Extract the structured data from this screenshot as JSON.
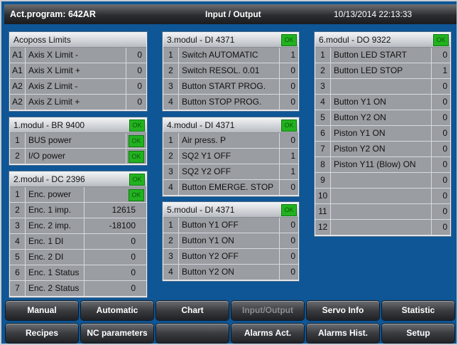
{
  "header": {
    "program": "Act.program: 642AR",
    "title": "Input / Output",
    "datetime": "10/13/2014 22:13:33"
  },
  "acoposs": {
    "title": "Acoposs Limits",
    "rows": [
      {
        "idx": "A1",
        "label": "Axis X Limit -",
        "value": "0"
      },
      {
        "idx": "A1",
        "label": "Axis X Limit +",
        "value": "0"
      },
      {
        "idx": "A2",
        "label": "Axis Z Limit -",
        "value": "0"
      },
      {
        "idx": "A2",
        "label": "Axis Z Limit +",
        "value": "0"
      }
    ]
  },
  "mod1": {
    "title": "1.modul - BR 9400",
    "ok": "OK",
    "rows": [
      {
        "idx": "1",
        "label": "BUS power",
        "value": "OK"
      },
      {
        "idx": "2",
        "label": "I/O power",
        "value": "OK"
      }
    ]
  },
  "mod2": {
    "title": "2.modul - DC 2396",
    "ok": "OK",
    "rows": [
      {
        "idx": "1",
        "label": "Enc. power",
        "value": "OK"
      },
      {
        "idx": "2",
        "label": "Enc. 1 imp.",
        "value": "12615"
      },
      {
        "idx": "3",
        "label": "Enc. 2 imp.",
        "value": "-18100"
      },
      {
        "idx": "4",
        "label": "Enc. 1 DI",
        "value": "0"
      },
      {
        "idx": "5",
        "label": "Enc. 2 DI",
        "value": "0"
      },
      {
        "idx": "6",
        "label": "Enc. 1 Status",
        "value": "0"
      },
      {
        "idx": "7",
        "label": "Enc. 2 Status",
        "value": "0"
      }
    ]
  },
  "mod3": {
    "title": "3.modul - DI 4371",
    "ok": "OK",
    "rows": [
      {
        "idx": "1",
        "label": "Switch AUTOMATIC",
        "value": "1"
      },
      {
        "idx": "2",
        "label": "Switch RESOL. 0.01",
        "value": "0"
      },
      {
        "idx": "3",
        "label": "Button START PROG.",
        "value": "0"
      },
      {
        "idx": "4",
        "label": "Button STOP PROG.",
        "value": "0"
      }
    ]
  },
  "mod4": {
    "title": "4.modul - DI 4371",
    "ok": "OK",
    "rows": [
      {
        "idx": "1",
        "label": "Air press. P",
        "value": "0"
      },
      {
        "idx": "2",
        "label": "SQ2 Y1 OFF",
        "value": "1"
      },
      {
        "idx": "3",
        "label": "SQ2 Y2 OFF",
        "value": "1"
      },
      {
        "idx": "4",
        "label": "Button EMERGE. STOP",
        "value": "0"
      }
    ]
  },
  "mod5": {
    "title": "5.modul - DI 4371",
    "ok": "OK",
    "rows": [
      {
        "idx": "1",
        "label": "Button Y1 OFF",
        "value": "0"
      },
      {
        "idx": "2",
        "label": "Button Y1 ON",
        "value": "0"
      },
      {
        "idx": "3",
        "label": "Button Y2 OFF",
        "value": "0"
      },
      {
        "idx": "4",
        "label": "Button Y2 ON",
        "value": "0"
      }
    ]
  },
  "mod6": {
    "title": "6.modul - DO 9322",
    "ok": "OK",
    "rows": [
      {
        "idx": "1",
        "label": "Button LED START",
        "value": "0"
      },
      {
        "idx": "2",
        "label": "Button LED STOP",
        "value": "1"
      },
      {
        "idx": "3",
        "label": "",
        "value": "0"
      },
      {
        "idx": "4",
        "label": "Button Y1 ON",
        "value": "0"
      },
      {
        "idx": "5",
        "label": "Button Y2 ON",
        "value": "0"
      },
      {
        "idx": "6",
        "label": "Piston Y1 ON",
        "value": "0"
      },
      {
        "idx": "7",
        "label": "Piston Y2 ON",
        "value": "0"
      },
      {
        "idx": "8",
        "label": "Piston Y11 (Blow) ON",
        "value": "0"
      },
      {
        "idx": "9",
        "label": "",
        "value": "0"
      },
      {
        "idx": "10",
        "label": "",
        "value": "0"
      },
      {
        "idx": "11",
        "label": "",
        "value": "0"
      },
      {
        "idx": "12",
        "label": "",
        "value": "0"
      }
    ]
  },
  "nav": {
    "row1": [
      "Manual",
      "Automatic",
      "Chart",
      "Input/Output",
      "Servo Info",
      "Statistic"
    ],
    "row2": [
      "Recipes",
      "NC parameters",
      "",
      "Alarms Act.",
      "Alarms Hist.",
      "Setup"
    ]
  }
}
